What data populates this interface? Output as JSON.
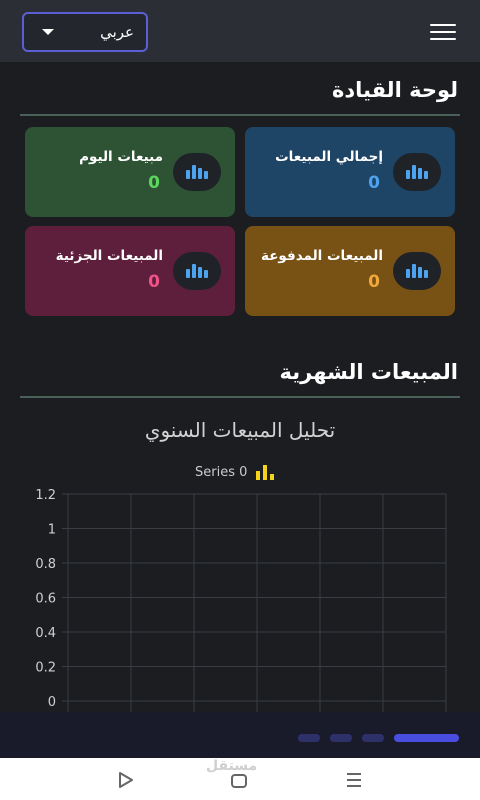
{
  "header": {
    "language_label": "عربي",
    "menu_icon": "hamburger-icon"
  },
  "dashboard": {
    "title": "لوحة القيادة",
    "cards": [
      {
        "label": "إجمالي المبيعات",
        "value": "0",
        "bg": "#1e4466",
        "value_color": "#4ea3ee"
      },
      {
        "label": "مبيعات اليوم",
        "value": "0",
        "bg": "#2d5234",
        "value_color": "#5cd65c"
      },
      {
        "label": "المبيعات المدفوعة",
        "value": "0",
        "bg": "#785114",
        "value_color": "#f0a93a"
      },
      {
        "label": "المبيعات الجزئية",
        "value": "0",
        "bg": "#5e1f3c",
        "value_color": "#f0528a"
      }
    ],
    "card_icon": "bar-chart-icon"
  },
  "monthly": {
    "title": "المبيعات الشهرية"
  },
  "chart_data": {
    "type": "bar",
    "title": "تحليل المبيعات السنوي",
    "series": [
      {
        "name": "Series 0",
        "values": []
      }
    ],
    "categories": [],
    "ylim": [
      0,
      1.2
    ],
    "y_ticks": [
      "0",
      "0.2",
      "0.4",
      "0.6",
      "0.8",
      "1",
      "1.2"
    ],
    "grid": true,
    "legend_position": "top",
    "colors": {
      "legend_icon": "#f5d31b",
      "grid": "#3a3d42",
      "tick_text": "#cfcfcf"
    }
  },
  "bottom_nav": {
    "watermark": "مستقل"
  }
}
